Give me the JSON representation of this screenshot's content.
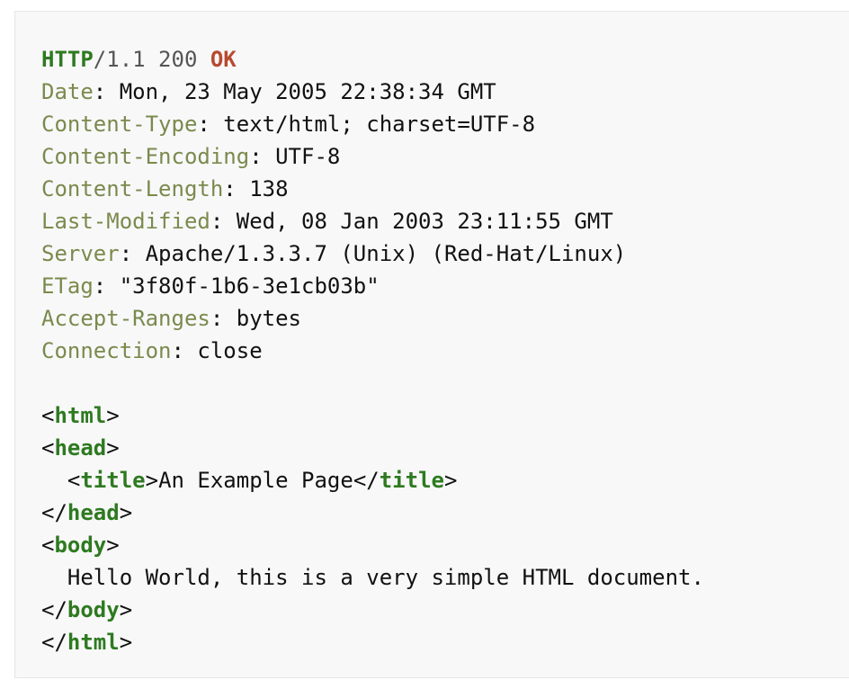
{
  "status_line": {
    "protocol": "HTTP",
    "version_status": "/1.1 200 ",
    "reason": "OK"
  },
  "headers": [
    {
      "name": "Date",
      "value": "Mon, 23 May 2005 22:38:34 GMT"
    },
    {
      "name": "Content-Type",
      "value": "text/html; charset=UTF-8"
    },
    {
      "name": "Content-Encoding",
      "value": "UTF-8"
    },
    {
      "name": "Content-Length",
      "value": "138"
    },
    {
      "name": "Last-Modified",
      "value": "Wed, 08 Jan 2003 23:11:55 GMT"
    },
    {
      "name": "Server",
      "value": "Apache/1.3.3.7 (Unix) (Red-Hat/Linux)"
    },
    {
      "name": "ETag",
      "value": "\"3f80f-1b6-3e1cb03b\""
    },
    {
      "name": "Accept-Ranges",
      "value": "bytes"
    },
    {
      "name": "Connection",
      "value": "close"
    }
  ],
  "html_body": {
    "tag_html": "html",
    "tag_head": "head",
    "tag_title": "title",
    "title_text": "An Example Page",
    "tag_body": "body",
    "body_text": "Hello World, this is a very simple HTML document."
  },
  "colors": {
    "panel_background": "#f8f8f9",
    "keyword_green": "#2e7a20",
    "header_name": "#7a8a4d",
    "status_ok": "#b84a2f"
  }
}
